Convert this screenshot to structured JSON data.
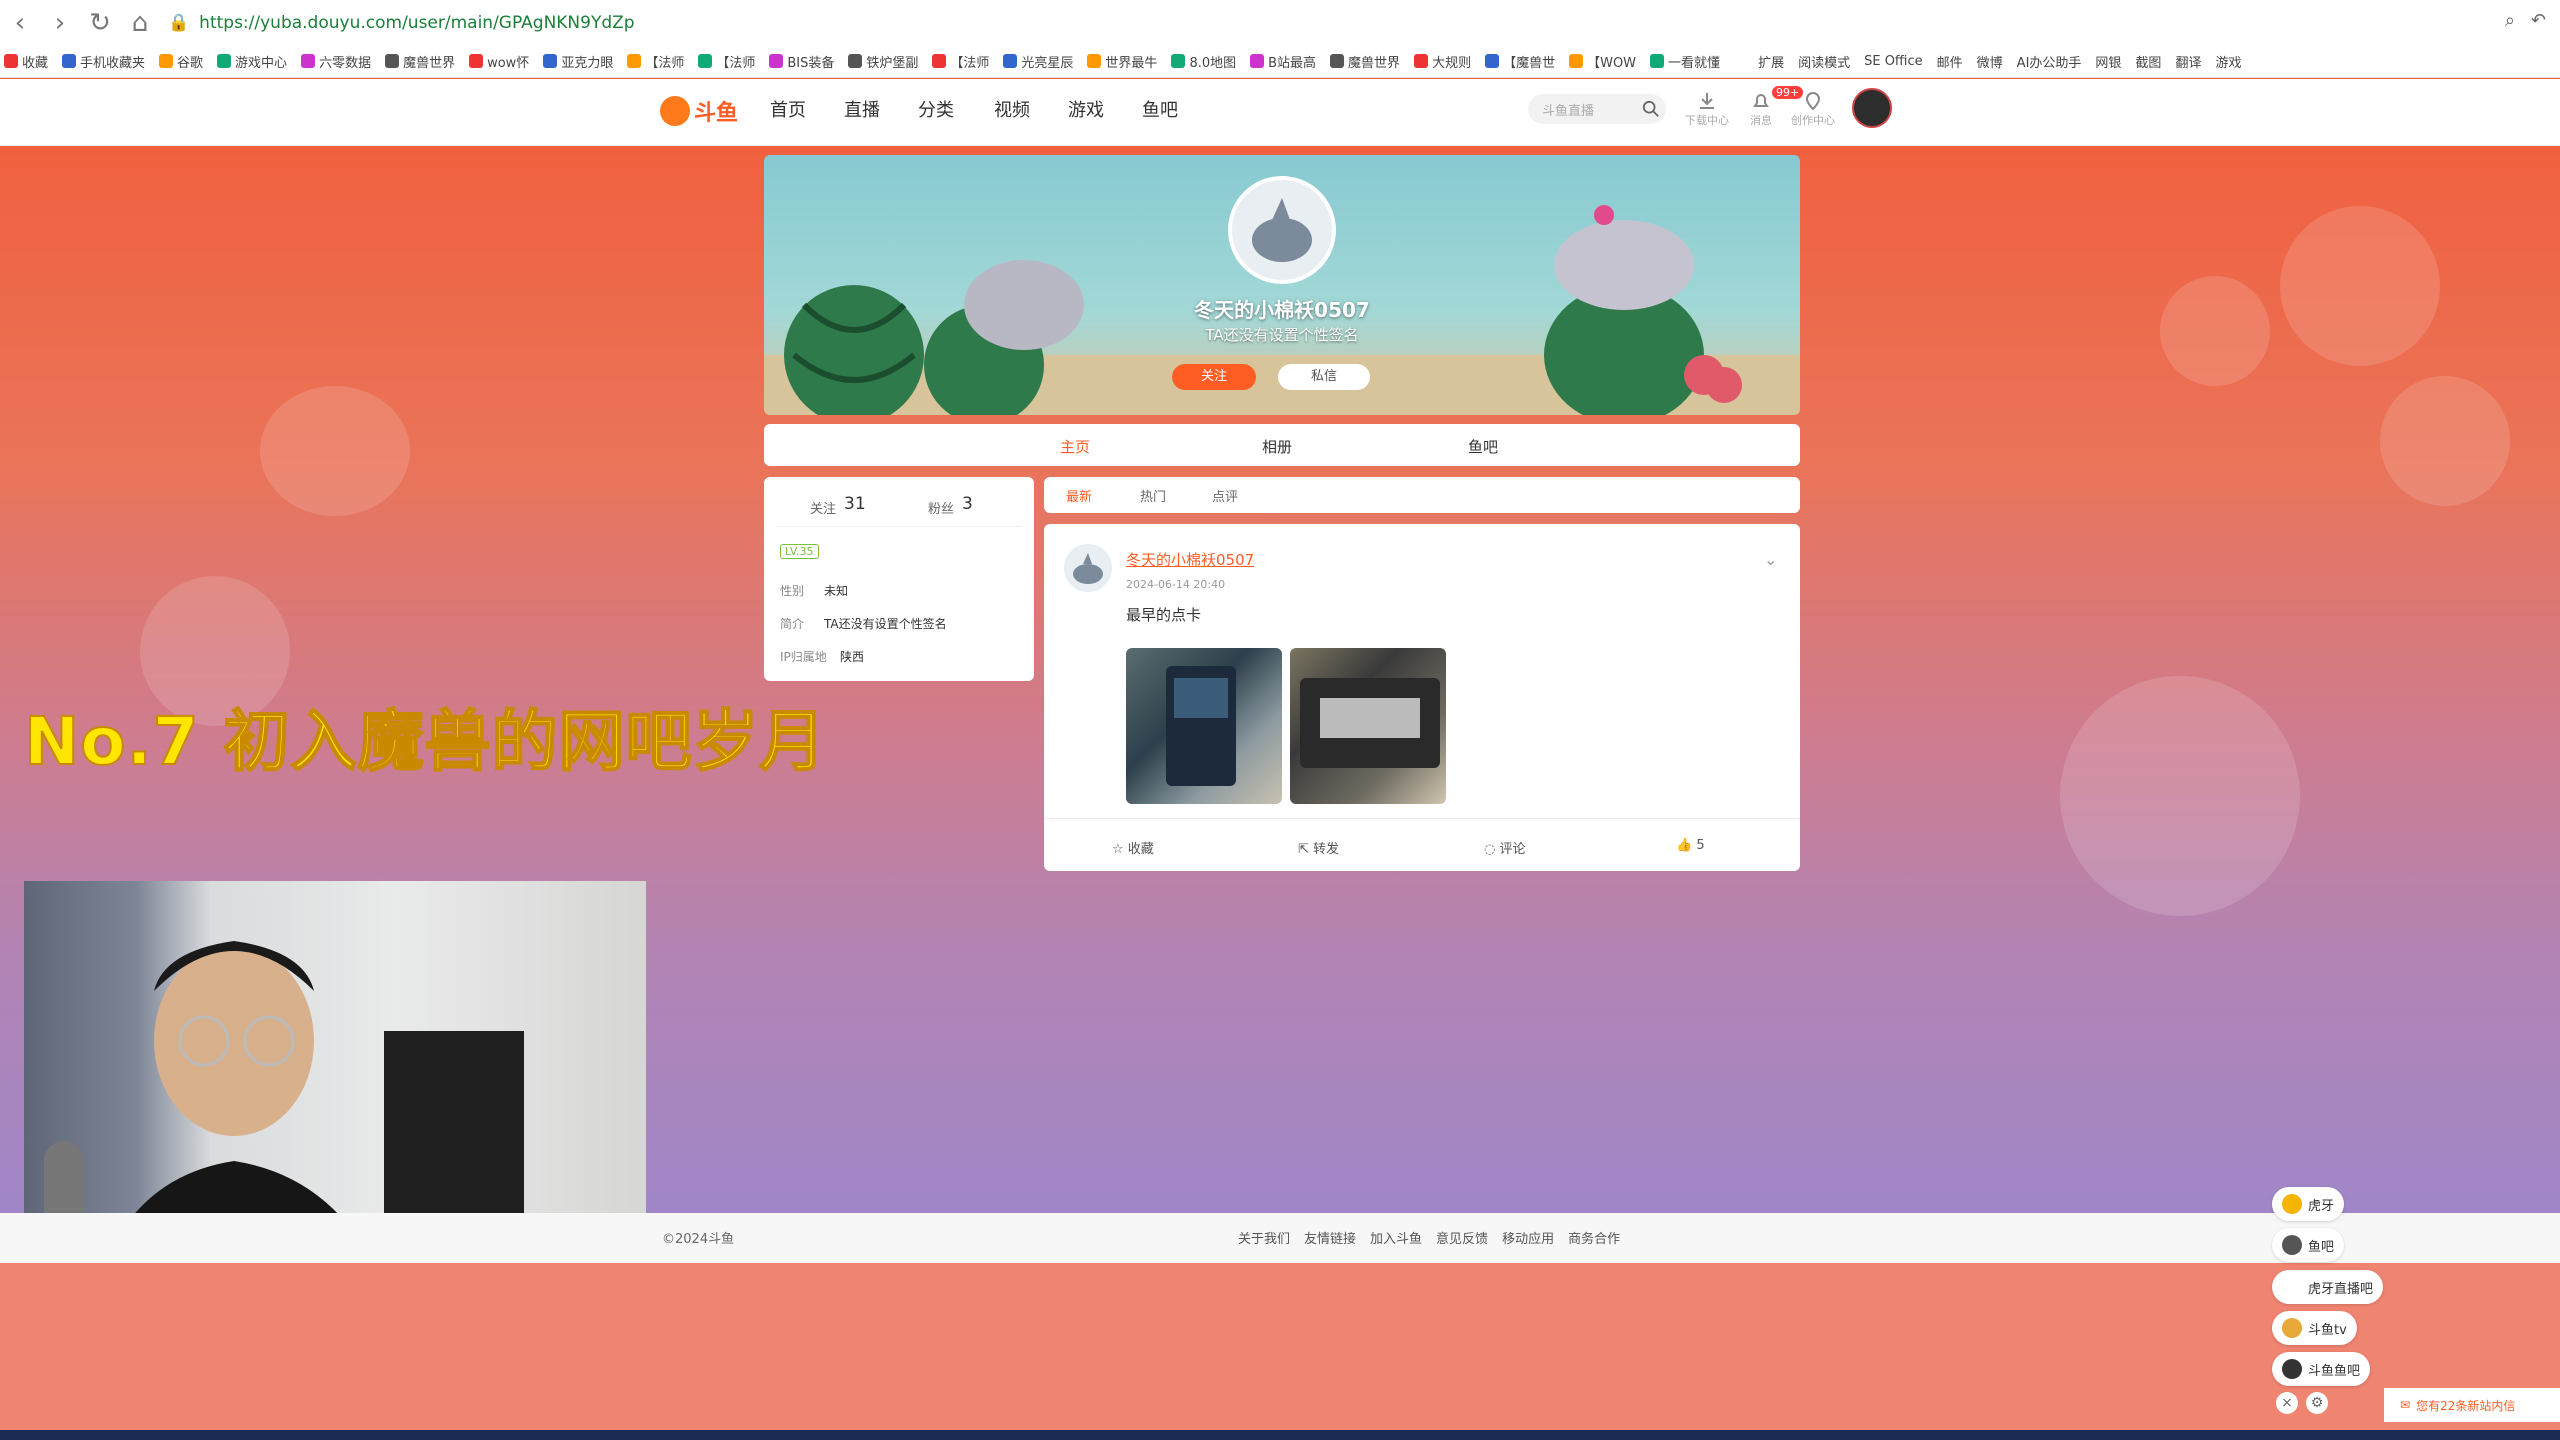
{
  "browser": {
    "url": "https://yuba.douyu.com/user/main/GPAgNKN9YdZp",
    "bookmarks": [
      "收藏",
      "手机收藏夹",
      "谷歌",
      "游戏中心",
      "六零数据",
      "魔兽世界",
      "wow怀",
      "亚克力眼",
      "【法师",
      "【法师",
      "BIS装备",
      "铁炉堡副",
      "【法师",
      "光亮星辰",
      "世界最牛",
      "8.0地图",
      "B站最高",
      "魔兽世界",
      "大规则",
      "【魔兽世",
      "【WOW",
      "一看就懂"
    ],
    "right_tools": [
      "扩展",
      "阅读模式",
      "SE Office",
      "邮件",
      "微博",
      "AI办公助手",
      "网银",
      "截图",
      "翻译",
      "游戏"
    ]
  },
  "site_nav": {
    "logo_text": "斗鱼",
    "links": [
      "首页",
      "直播",
      "分类",
      "视频",
      "游戏",
      "鱼吧"
    ],
    "search_placeholder": "斗鱼直播",
    "tools": [
      "下载中心",
      "消息",
      "创作中心"
    ],
    "badge": "99+"
  },
  "profile": {
    "name": "冬天的小棉袄0507",
    "signature": "TA还没有设置个性签名",
    "follow_label": "关注",
    "message_label": "私信"
  },
  "tabs": [
    "主页",
    "相册",
    "鱼吧"
  ],
  "stats": {
    "following_label": "关注",
    "following": "31",
    "fans_label": "粉丝",
    "fans": "3",
    "level": "LV.35",
    "gender_label": "性别",
    "gender": "未知",
    "bio_label": "简介",
    "bio": "TA还没有设置个性签名",
    "ip_label": "IP归属地",
    "ip": "陕西"
  },
  "sub_tabs": [
    "最新",
    "热门",
    "点评"
  ],
  "post": {
    "author": "冬天的小棉袄0507",
    "time": "2024-06-14 20:40",
    "text": "最早的点卡",
    "actions": {
      "collect": "收藏",
      "forward": "转发",
      "comment": "评论",
      "like": "5"
    }
  },
  "overlay_title": "No.7 初入魔兽的网吧岁月",
  "footer": {
    "copyright": "©2024斗鱼",
    "links": [
      "关于我们",
      "友情链接",
      "加入斗鱼",
      "意见反馈",
      "移动应用",
      "商务合作"
    ]
  },
  "floating": [
    "虎牙",
    "鱼吧",
    "虎牙直播吧",
    "斗鱼tv",
    "斗鱼鱼吧"
  ],
  "mail_notice": "您有22条新站内信"
}
